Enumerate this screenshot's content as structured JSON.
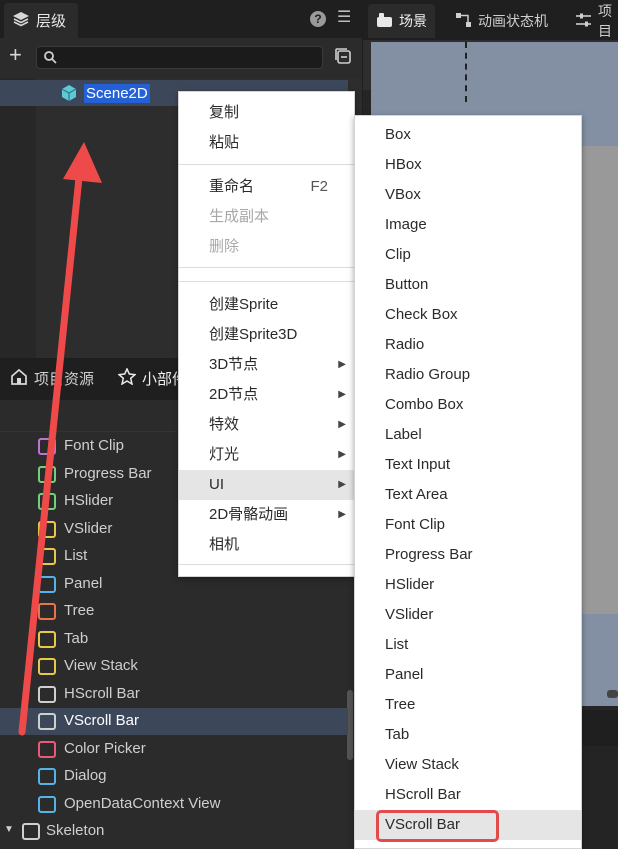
{
  "hierarchy": {
    "tab_label": "层级",
    "scene_node": "Scene2D"
  },
  "widgets_panel": {
    "tabs": [
      "项目资源",
      "小部件"
    ],
    "items": [
      {
        "label": "Font Clip",
        "icon": "font-clip-icon",
        "color": "#c46fd6"
      },
      {
        "label": "Progress Bar",
        "icon": "progress-bar-icon",
        "color": "#6fd17b"
      },
      {
        "label": "HSlider",
        "icon": "hslider-icon",
        "color": "#6fd17b"
      },
      {
        "label": "VSlider",
        "icon": "vslider-icon",
        "color": "#e8c84a"
      },
      {
        "label": "List",
        "icon": "list-icon",
        "color": "#e8c84a"
      },
      {
        "label": "Panel",
        "icon": "panel-icon",
        "color": "#54b4e8"
      },
      {
        "label": "Tree",
        "icon": "tree-icon",
        "color": "#e8744a"
      },
      {
        "label": "Tab",
        "icon": "tab-icon",
        "color": "#e8c84a"
      },
      {
        "label": "View Stack",
        "icon": "view-stack-icon",
        "color": "#e8c84a"
      },
      {
        "label": "HScroll Bar",
        "icon": "hscroll-bar-icon",
        "color": "#cfcfcf"
      },
      {
        "label": "VScroll Bar",
        "icon": "vscroll-bar-icon",
        "color": "#cfcfcf"
      },
      {
        "label": "Color Picker",
        "icon": "color-picker-icon",
        "color": "#e85a7a"
      },
      {
        "label": "Dialog",
        "icon": "dialog-icon",
        "color": "#54b4e8"
      },
      {
        "label": "OpenDataContext View",
        "icon": "open-data-icon",
        "color": "#54b4e8"
      },
      {
        "label": "Skeleton",
        "icon": "skeleton-icon",
        "color": "#cfcfcf"
      }
    ],
    "selected_index": 10
  },
  "scene_panel": {
    "tabs": [
      "场景",
      "动画状态机",
      "项目"
    ]
  },
  "context_menu": {
    "items": [
      {
        "label": "复制",
        "state": "normal"
      },
      {
        "label": "粘贴",
        "state": "normal"
      },
      {
        "label": "重命名",
        "shortcut": "F2",
        "state": "normal"
      },
      {
        "label": "生成副本",
        "state": "disabled"
      },
      {
        "label": "删除",
        "state": "disabled"
      },
      {
        "label": "创建Sprite",
        "state": "normal"
      },
      {
        "label": "创建Sprite3D",
        "state": "normal"
      },
      {
        "label": "3D节点",
        "state": "submenu"
      },
      {
        "label": "2D节点",
        "state": "submenu"
      },
      {
        "label": "特效",
        "state": "submenu"
      },
      {
        "label": "灯光",
        "state": "submenu"
      },
      {
        "label": "UI",
        "state": "submenu-open"
      },
      {
        "label": "2D骨骼动画",
        "state": "submenu"
      },
      {
        "label": "相机",
        "state": "normal"
      }
    ]
  },
  "ui_submenu": {
    "items": [
      "Box",
      "HBox",
      "VBox",
      "Image",
      "Clip",
      "Button",
      "Check Box",
      "Radio",
      "Radio Group",
      "Combo Box",
      "Label",
      "Text Input",
      "Text Area",
      "Font Clip",
      "Progress Bar",
      "HSlider",
      "VSlider",
      "List",
      "Panel",
      "Tree",
      "Tab",
      "View Stack",
      "HScroll Bar",
      "VScroll Bar"
    ],
    "highlighted": "VScroll Bar"
  },
  "colors": {
    "selection_blue": "#2461d6",
    "row_highlight": "#3c4759",
    "annotation_red": "#e34a4a",
    "viewport_bg": "#8390a4"
  }
}
